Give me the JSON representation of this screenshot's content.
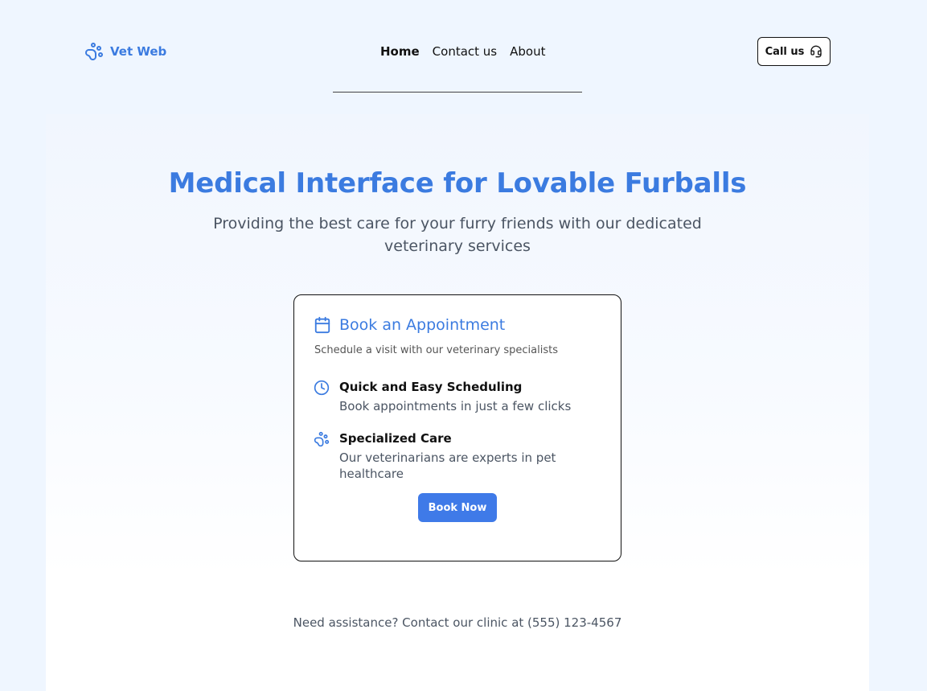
{
  "brand": {
    "name": "Vet Web",
    "icon": "paw-icon"
  },
  "nav": {
    "items": [
      {
        "label": "Home",
        "active": true
      },
      {
        "label": "Contact us",
        "active": false
      },
      {
        "label": "About",
        "active": false
      }
    ]
  },
  "header": {
    "call_label": "Call us",
    "call_icon": "headset-icon"
  },
  "hero": {
    "title": "Medical Interface for Lovable Furballs",
    "subtitle": "Providing the best care for your furry friends with our dedicated veterinary services"
  },
  "card": {
    "title": "Book an Appointment",
    "title_icon": "calendar-icon",
    "description": "Schedule a visit with our veterinary specialists",
    "features": [
      {
        "icon": "clock-icon",
        "title": "Quick and Easy Scheduling",
        "text": "Book appointments in just a few clicks"
      },
      {
        "icon": "paw-icon",
        "title": "Specialized Care",
        "text": "Our veterinarians are experts in pet healthcare"
      }
    ],
    "button_label": "Book Now"
  },
  "footer": {
    "note": "Need assistance? Contact our clinic at (555) 123-4567"
  },
  "colors": {
    "accent": "#3b7be0",
    "button": "#3f7ae8",
    "background": "#eff6ff",
    "muted_text": "#4b5563"
  }
}
